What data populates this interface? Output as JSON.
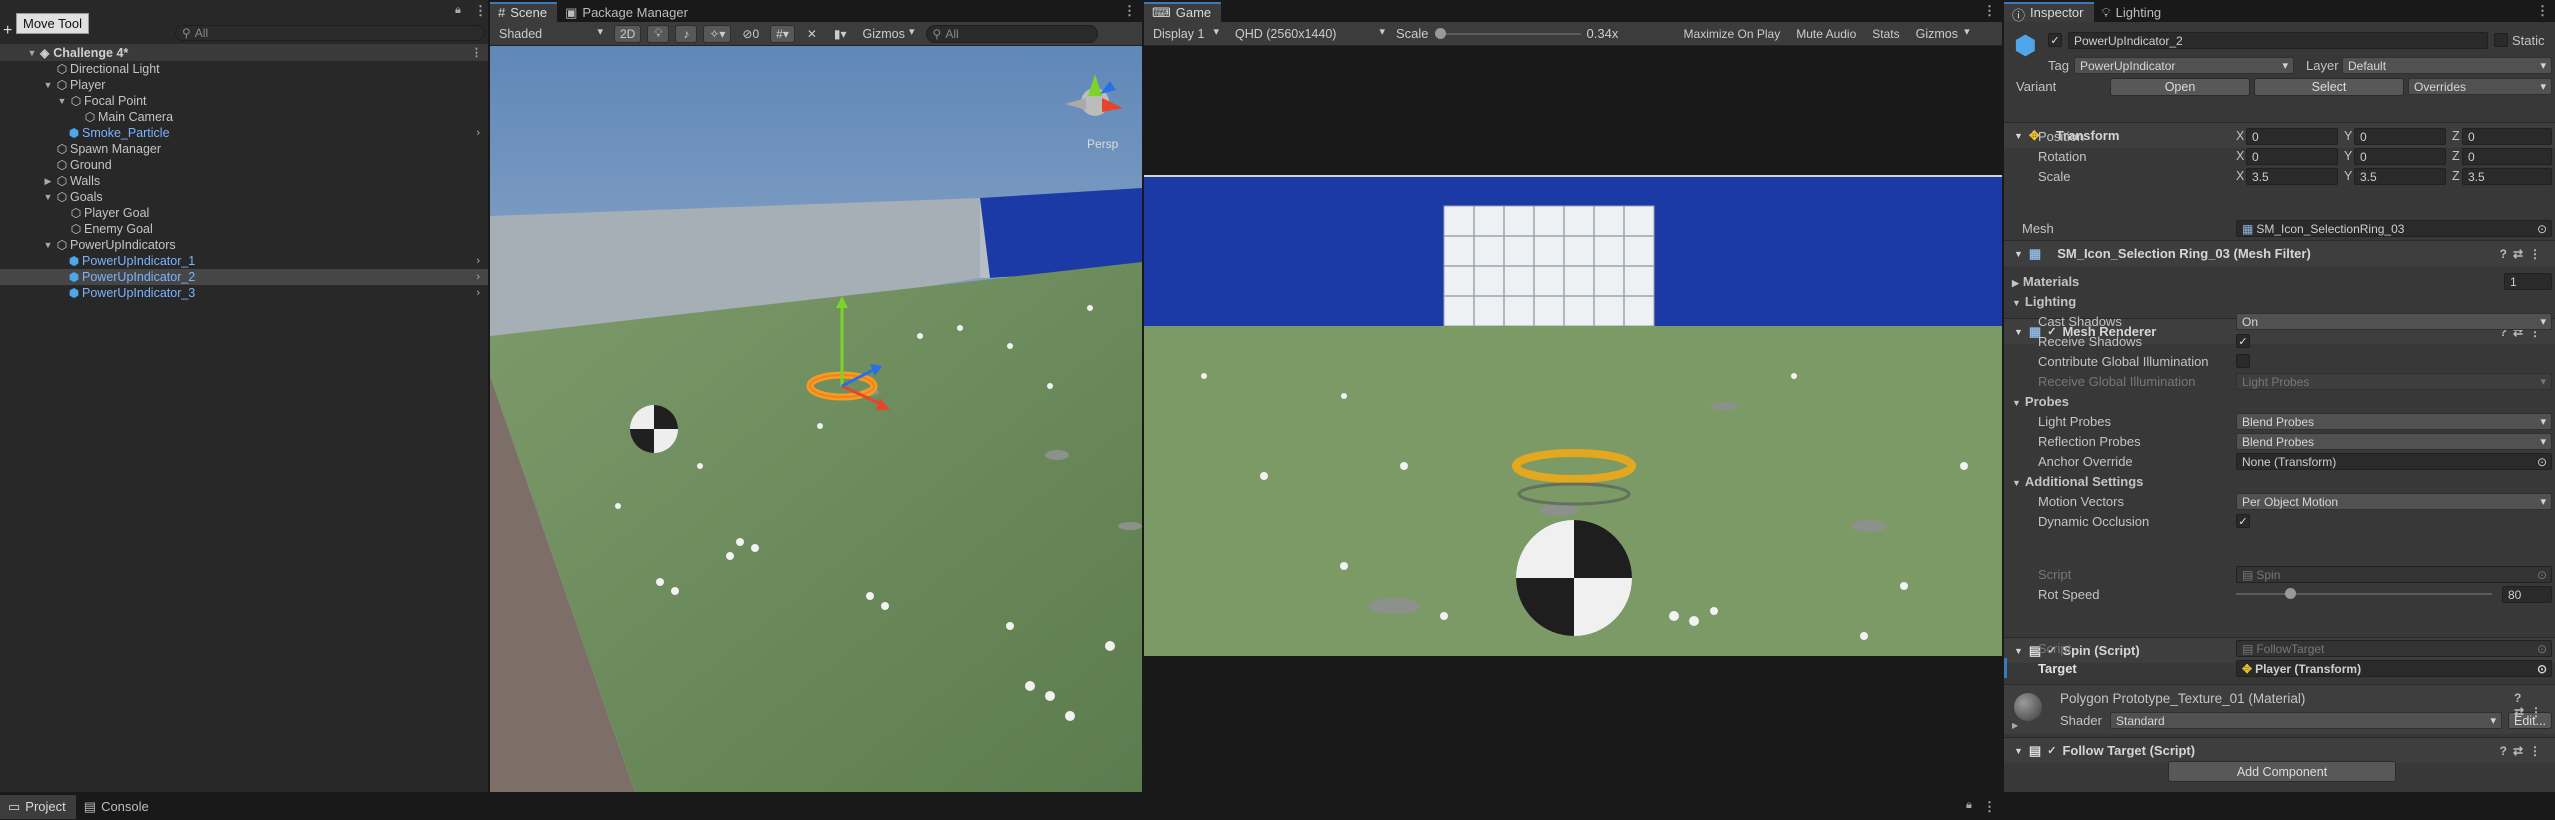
{
  "hierarchy": {
    "tool_tooltip": "Move Tool",
    "search_placeholder": "All",
    "scene_name": "Challenge 4*",
    "rows": [
      {
        "label": "Directional Light"
      },
      {
        "label": "Player"
      },
      {
        "label": "Focal Point"
      },
      {
        "label": "Main Camera"
      },
      {
        "label": "Smoke_Particle"
      },
      {
        "label": "Spawn Manager"
      },
      {
        "label": "Ground"
      },
      {
        "label": "Walls"
      },
      {
        "label": "Goals"
      },
      {
        "label": "Player Goal"
      },
      {
        "label": "Enemy Goal"
      },
      {
        "label": "PowerUpIndicators"
      },
      {
        "label": "PowerUpIndicator_1"
      },
      {
        "label": "PowerUpIndicator_2"
      },
      {
        "label": "PowerUpIndicator_3"
      }
    ]
  },
  "scene": {
    "tab_scene": "Scene",
    "tab_package": "Package Manager",
    "shading": "Shaded",
    "mode_2d": "2D",
    "hidden_count": "0",
    "gizmos": "Gizmos",
    "search_placeholder": "All",
    "persp": "Persp"
  },
  "game": {
    "tab": "Game",
    "display": "Display 1",
    "resolution": "QHD (2560x1440)",
    "scale_label": "Scale",
    "scale_value": "0.34x",
    "scale_fraction": 0.0,
    "maximize": "Maximize On Play",
    "mute": "Mute Audio",
    "stats": "Stats",
    "gizmos": "Gizmos"
  },
  "bottom": {
    "project": "Project",
    "console": "Console"
  },
  "inspector": {
    "tab_inspector": "Inspector",
    "tab_lighting": "Lighting",
    "object_name": "PowerUpIndicator_2",
    "static_label": "Static",
    "tag_label": "Tag",
    "tag_value": "PowerUpIndicator",
    "layer_label": "Layer",
    "layer_value": "Default",
    "variant_label": "Variant",
    "open_btn": "Open",
    "select_btn": "Select",
    "overrides_value": "Overrides",
    "transform": {
      "title": "Transform",
      "position_label": "Position",
      "rotation_label": "Rotation",
      "scale_label": "Scale",
      "axis_x": "X",
      "axis_y": "Y",
      "axis_z": "Z",
      "position": [
        "0",
        "0",
        "0"
      ],
      "rotation": [
        "0",
        "0",
        "0"
      ],
      "scale": [
        "3.5",
        "3.5",
        "3.5"
      ]
    },
    "mesh_filter": {
      "title": "SM_Icon_Selection Ring_03 (Mesh Filter)",
      "mesh_label": "Mesh",
      "mesh_value": "SM_Icon_SelectionRing_03"
    },
    "mesh_renderer": {
      "title": "Mesh Renderer",
      "materials_label": "Materials",
      "materials_count": "1",
      "lighting_header": "Lighting",
      "cast_shadows_label": "Cast Shadows",
      "cast_shadows_value": "On",
      "receive_shadows_label": "Receive Shadows",
      "contribute_gi_label": "Contribute Global Illumination",
      "receive_gi_label": "Receive Global Illumination",
      "receive_gi_value": "Light Probes",
      "probes_header": "Probes",
      "light_probes_label": "Light Probes",
      "light_probes_value": "Blend Probes",
      "reflection_probes_label": "Reflection Probes",
      "reflection_probes_value": "Blend Probes",
      "anchor_label": "Anchor Override",
      "anchor_value": "None (Transform)",
      "additional_header": "Additional Settings",
      "motion_vectors_label": "Motion Vectors",
      "motion_vectors_value": "Per Object Motion",
      "dynamic_occlusion_label": "Dynamic Occlusion"
    },
    "spin": {
      "title": "Spin (Script)",
      "script_label": "Script",
      "script_value": "Spin",
      "rot_speed_label": "Rot Speed",
      "rot_speed_value": "80",
      "rot_speed_fraction": 0.2
    },
    "follow": {
      "title": "Follow Target (Script)",
      "script_label": "Script",
      "script_value": "FollowTarget",
      "target_label": "Target",
      "target_value": "Player (Transform)"
    },
    "material": {
      "title": "Polygon Prototype_Texture_01 (Material)",
      "shader_label": "Shader",
      "shader_value": "Standard",
      "edit_btn": "Edit..."
    },
    "add_component": "Add Component"
  }
}
